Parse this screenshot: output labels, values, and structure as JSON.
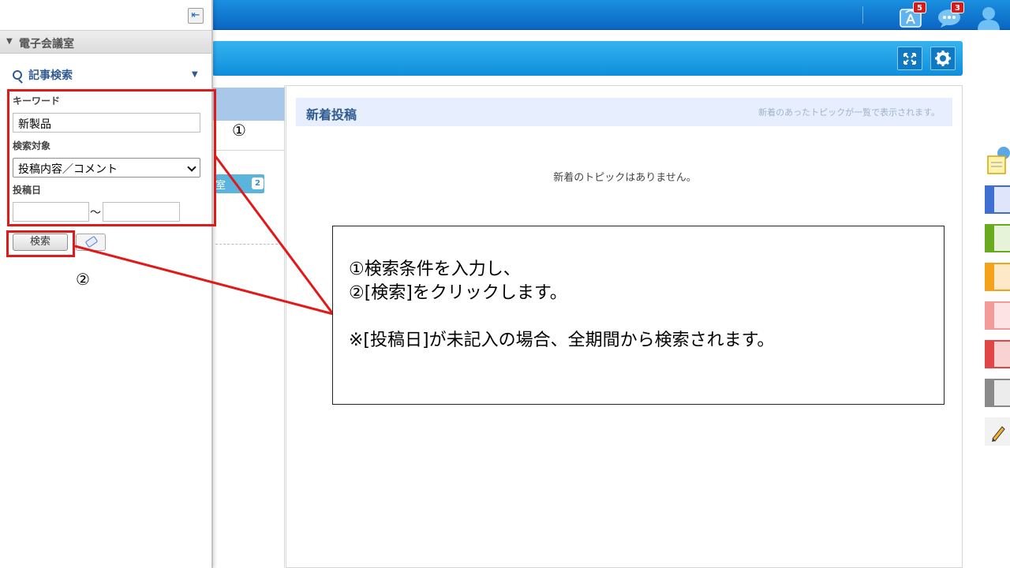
{
  "header": {
    "notification_count": "5",
    "message_count": "3",
    "notification_icon": "broadcast-icon",
    "message_icon": "chat-bubble-icon",
    "user_icon": "user-icon"
  },
  "sidebar": {
    "section_title": "電子会議室",
    "search_title": "記事検索",
    "keyword_label": "キーワード",
    "keyword_value": "新製品",
    "target_label": "検索対象",
    "target_value": "投稿内容／コメント",
    "date_label": "投稿日",
    "date_separator": "〜",
    "search_button": "検索"
  },
  "background": {
    "room_badge_count": "2",
    "room_label_fragment": "室"
  },
  "main": {
    "new_posts_title": "新着投稿",
    "new_posts_desc": "新着のあったトピックが一覧で表示されます。",
    "empty_message": "新着のトピックはありません。"
  },
  "annotation": {
    "marker1": "①",
    "marker2": "②",
    "line1": "①検索条件を入力し、",
    "line2": "②[検索]をクリックします。",
    "note": "※[投稿日]が未記入の場合、全期間から検索されます。"
  },
  "colors": {
    "header_blue": "#0a66c2",
    "subbar_blue": "#1a9ae6",
    "annotation_red": "#e11919",
    "title_blue": "#2f5b8f"
  }
}
